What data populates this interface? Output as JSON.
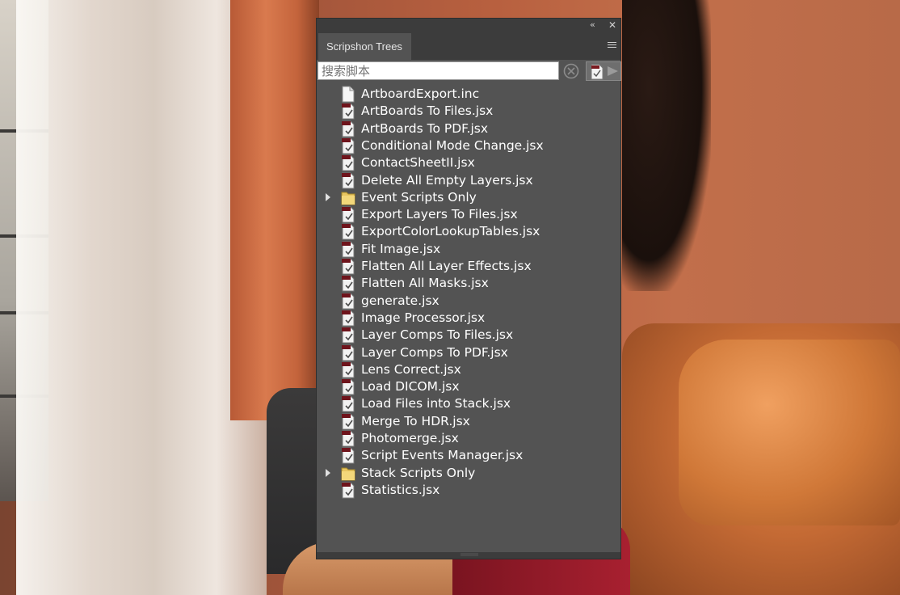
{
  "panel": {
    "tab_label": "Scripshon Trees",
    "collapse_glyph": "‹‹",
    "close_glyph": "✕",
    "menu_icon": "hamburger-menu-icon"
  },
  "search": {
    "placeholder": "搜索脚本",
    "value": ""
  },
  "tree": {
    "items": [
      {
        "label": "ArtboardExport.inc",
        "type": "file"
      },
      {
        "label": "ArtBoards To Files.jsx",
        "type": "script"
      },
      {
        "label": "ArtBoards To PDF.jsx",
        "type": "script"
      },
      {
        "label": "Conditional Mode Change.jsx",
        "type": "script"
      },
      {
        "label": "ContactSheetII.jsx",
        "type": "script"
      },
      {
        "label": "Delete All Empty Layers.jsx",
        "type": "script"
      },
      {
        "label": "Event Scripts Only",
        "type": "folder"
      },
      {
        "label": "Export Layers To Files.jsx",
        "type": "script"
      },
      {
        "label": "ExportColorLookupTables.jsx",
        "type": "script"
      },
      {
        "label": "Fit Image.jsx",
        "type": "script"
      },
      {
        "label": "Flatten All Layer Effects.jsx",
        "type": "script"
      },
      {
        "label": "Flatten All Masks.jsx",
        "type": "script"
      },
      {
        "label": "generate.jsx",
        "type": "script"
      },
      {
        "label": "Image Processor.jsx",
        "type": "script"
      },
      {
        "label": "Layer Comps To Files.jsx",
        "type": "script"
      },
      {
        "label": "Layer Comps To PDF.jsx",
        "type": "script"
      },
      {
        "label": "Lens Correct.jsx",
        "type": "script"
      },
      {
        "label": "Load DICOM.jsx",
        "type": "script"
      },
      {
        "label": "Load Files into Stack.jsx",
        "type": "script"
      },
      {
        "label": "Merge To HDR.jsx",
        "type": "script"
      },
      {
        "label": "Photomerge.jsx",
        "type": "script"
      },
      {
        "label": "Script Events Manager.jsx",
        "type": "script"
      },
      {
        "label": "Stack Scripts Only",
        "type": "folder"
      },
      {
        "label": "Statistics.jsx",
        "type": "script"
      }
    ]
  }
}
